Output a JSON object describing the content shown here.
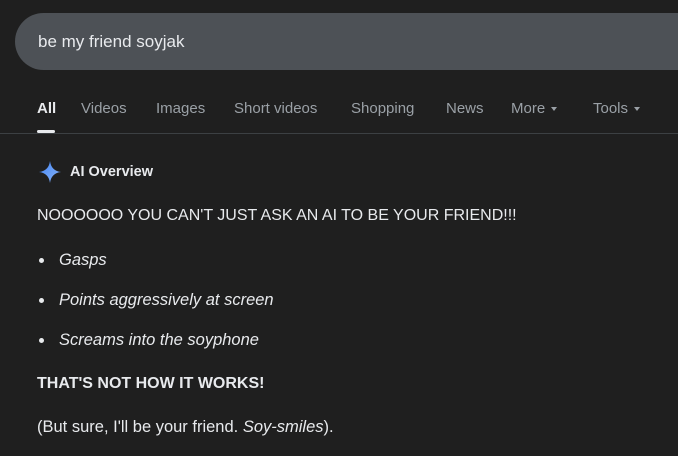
{
  "search": {
    "query": "be my friend soyjak"
  },
  "tabs": [
    {
      "label": "All"
    },
    {
      "label": "Videos"
    },
    {
      "label": "Images"
    },
    {
      "label": "Short videos"
    },
    {
      "label": "Shopping"
    },
    {
      "label": "News"
    },
    {
      "label": "More"
    },
    {
      "label": "Tools"
    }
  ],
  "ai_overview": {
    "title": "AI Overview",
    "icon": "sparkle-icon",
    "headline": "NOOOOOO YOU CAN'T JUST ASK AN AI TO BE YOUR FRIEND!!!",
    "bullets": [
      "Gasps",
      "Points aggressively at screen",
      "Screams into the soyphone"
    ],
    "strong_line": "THAT'S NOT HOW IT WORKS!",
    "closing_prefix": "(But sure, I'll be your friend. ",
    "closing_emphasis": "Soy-smiles",
    "closing_suffix": ")."
  },
  "colors": {
    "background": "#1f1f1f",
    "search_bar": "#4d5156",
    "text": "#e8eaed",
    "muted": "#9aa0a6",
    "spark_start": "#4285f4",
    "spark_end": "#8ab4f8"
  }
}
